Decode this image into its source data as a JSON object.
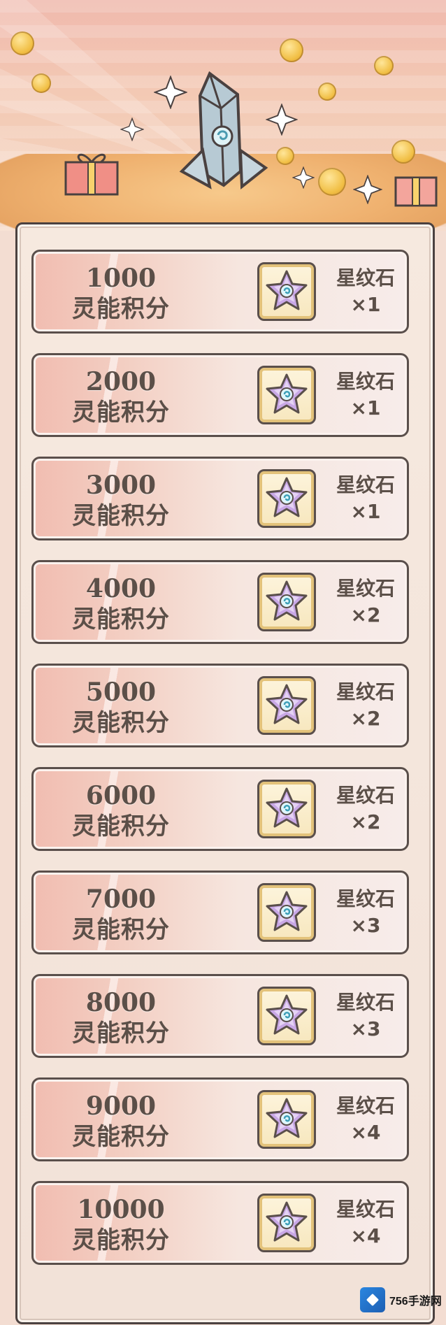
{
  "rewards": [
    {
      "score": "1000",
      "label": "灵能积分",
      "item": "星纹石",
      "qty": "×1"
    },
    {
      "score": "2000",
      "label": "灵能积分",
      "item": "星纹石",
      "qty": "×1"
    },
    {
      "score": "3000",
      "label": "灵能积分",
      "item": "星纹石",
      "qty": "×1"
    },
    {
      "score": "4000",
      "label": "灵能积分",
      "item": "星纹石",
      "qty": "×2"
    },
    {
      "score": "5000",
      "label": "灵能积分",
      "item": "星纹石",
      "qty": "×2"
    },
    {
      "score": "6000",
      "label": "灵能积分",
      "item": "星纹石",
      "qty": "×2"
    },
    {
      "score": "7000",
      "label": "灵能积分",
      "item": "星纹石",
      "qty": "×3"
    },
    {
      "score": "8000",
      "label": "灵能积分",
      "item": "星纹石",
      "qty": "×3"
    },
    {
      "score": "9000",
      "label": "灵能积分",
      "item": "星纹石",
      "qty": "×4"
    },
    {
      "score": "10000",
      "label": "灵能积分",
      "item": "星纹石",
      "qty": "×4"
    }
  ],
  "watermark": {
    "text": "756手游网"
  },
  "icons": {
    "banner": "crystal-icon",
    "reward": "star-stone-icon"
  },
  "colors": {
    "text": "#5b4f48",
    "border": "#5a4f4b",
    "row_gradient_start": "#f1bdb1",
    "row_gradient_end": "#f7ecea",
    "icon_frame": "#e3c27a"
  }
}
